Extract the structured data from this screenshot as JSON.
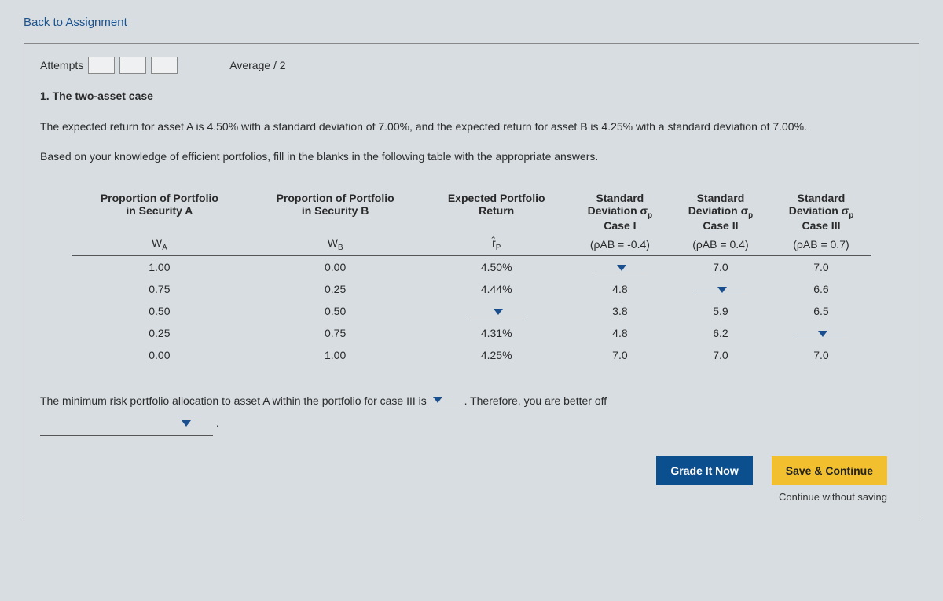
{
  "back_link": "Back to Assignment",
  "attempts_label": "Attempts",
  "average_label": "Average / 2",
  "section_heading": "1. The two-asset case",
  "paragraph1": "The expected return for asset A is 4.50% with a standard deviation of 7.00%, and the expected return for asset B is 4.25% with a standard deviation of 7.00%.",
  "paragraph2": "Based on your knowledge of efficient portfolios, fill in the blanks in the following table with the appropriate answers.",
  "headers": {
    "propA_1": "Proportion of Portfolio",
    "propA_2": "in Security A",
    "propB_1": "Proportion of Portfolio",
    "propB_2": "in Security B",
    "ret_1": "Expected Portfolio",
    "ret_2": "Return",
    "sd_1": "Standard",
    "sd_2": "Deviation σ",
    "case1": "Case I",
    "case2": "Case II",
    "case3": "Case III",
    "wa": "W",
    "wb": "W",
    "rp": "r̂",
    "pab1": "(ρAB = -0.4)",
    "pab2": "(ρAB = 0.4)",
    "pab3": "(ρAB = 0.7)"
  },
  "rows": [
    {
      "wa": "1.00",
      "wb": "0.00",
      "rp": "4.50%",
      "c1": "",
      "c1_dd": true,
      "c2": "7.0",
      "c2_dd": false,
      "c3": "7.0",
      "c3_dd": false
    },
    {
      "wa": "0.75",
      "wb": "0.25",
      "rp": "4.44%",
      "c1": "4.8",
      "c1_dd": false,
      "c2": "",
      "c2_dd": true,
      "c3": "6.6",
      "c3_dd": false
    },
    {
      "wa": "0.50",
      "wb": "0.50",
      "rp": "",
      "rp_dd": true,
      "c1": "3.8",
      "c1_dd": false,
      "c2": "5.9",
      "c2_dd": false,
      "c3": "6.5",
      "c3_dd": false
    },
    {
      "wa": "0.25",
      "wb": "0.75",
      "rp": "4.31%",
      "c1": "4.8",
      "c1_dd": false,
      "c2": "6.2",
      "c2_dd": false,
      "c3": "",
      "c3_dd": true
    },
    {
      "wa": "0.00",
      "wb": "1.00",
      "rp": "4.25%",
      "c1": "7.0",
      "c1_dd": false,
      "c2": "7.0",
      "c2_dd": false,
      "c3": "7.0",
      "c3_dd": false
    }
  ],
  "sentence_part1": "The minimum risk portfolio allocation to asset A within the portfolio for case III is ",
  "sentence_part2": " . Therefore, you are better off",
  "sentence_part3": " .",
  "buttons": {
    "grade": "Grade It Now",
    "save": "Save & Continue",
    "continue_wo": "Continue without saving"
  }
}
